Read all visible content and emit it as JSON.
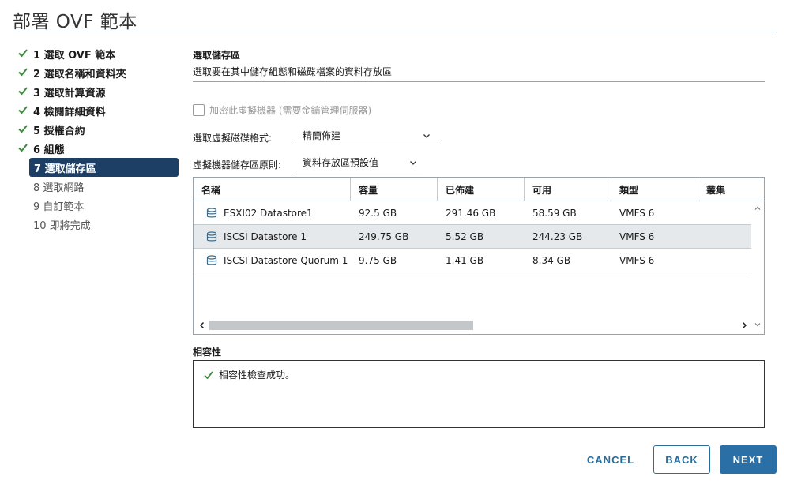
{
  "window": {
    "title": "部署 OVF 範本"
  },
  "steps": [
    {
      "label": "1 選取 OVF 範本",
      "state": "done"
    },
    {
      "label": "2 選取名稱和資料夾",
      "state": "done"
    },
    {
      "label": "3 選取計算資源",
      "state": "done"
    },
    {
      "label": "4 檢閱詳細資料",
      "state": "done"
    },
    {
      "label": "5 授權合約",
      "state": "done"
    },
    {
      "label": "6 組態",
      "state": "done"
    },
    {
      "label": "7 選取儲存區",
      "state": "active"
    },
    {
      "label": "8 選取網路",
      "state": "pending"
    },
    {
      "label": "9 自訂範本",
      "state": "pending"
    },
    {
      "label": "10 即將完成",
      "state": "pending"
    }
  ],
  "main": {
    "section_title": "選取儲存區",
    "section_desc": "選取要在其中儲存組態和磁碟檔案的資料存放區",
    "encrypt_label": "加密此虛擬機器 (需要金鑰管理伺服器)",
    "disk_format_label": "選取虛擬磁碟格式:",
    "disk_format_value": "精簡佈建",
    "storage_policy_label": "虛擬機器儲存區原則:",
    "storage_policy_value": "資料存放區預設值"
  },
  "table": {
    "columns": [
      "名稱",
      "容量",
      "已佈建",
      "可用",
      "類型",
      "叢集"
    ],
    "rows": [
      {
        "name": "ESXI02 Datastore1",
        "capacity": "92.5 GB",
        "provisioned": "291.46 GB",
        "free": "58.59 GB",
        "type": "VMFS 6",
        "cluster": "",
        "selected": false
      },
      {
        "name": "ISCSI Datastore 1",
        "capacity": "249.75 GB",
        "provisioned": "5.52 GB",
        "free": "244.23 GB",
        "type": "VMFS 6",
        "cluster": "",
        "selected": true
      },
      {
        "name": "ISCSI Datastore Quorum 1",
        "capacity": "9.75 GB",
        "provisioned": "1.41 GB",
        "free": "8.34 GB",
        "type": "VMFS 6",
        "cluster": "",
        "selected": false
      }
    ]
  },
  "compat": {
    "label": "相容性",
    "message": "相容性檢查成功。"
  },
  "buttons": {
    "cancel": "CANCEL",
    "back": "BACK",
    "next": "NEXT"
  },
  "colors": {
    "check_green": "#3d8a3d",
    "active_step": "#1d3f66",
    "primary": "#2a6fa6"
  }
}
